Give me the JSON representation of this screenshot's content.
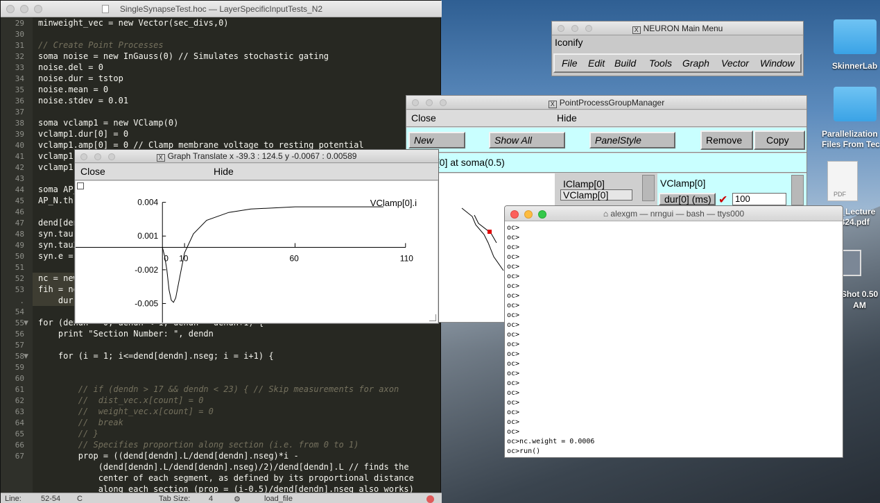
{
  "editor": {
    "title": "SingleSynapseTest.hoc — LayerSpecificInputTests_N2",
    "lines": [
      {
        "n": "29",
        "t": "minweight_vec = new Vector(sec_divs,0)"
      },
      {
        "n": "30",
        "t": ""
      },
      {
        "n": "31",
        "t": "// Create Point Processes"
      },
      {
        "n": "32",
        "t": "soma noise = new InGauss(0) // Simulates stochastic gating"
      },
      {
        "n": "33",
        "t": "noise.del = 0"
      },
      {
        "n": "34",
        "t": "noise.dur = tstop"
      },
      {
        "n": "35",
        "t": "noise.mean = 0"
      },
      {
        "n": "36",
        "t": "noise.stdev = 0.01"
      },
      {
        "n": "37",
        "t": ""
      },
      {
        "n": "38",
        "t": "soma vclamp1 = new VClamp(0)"
      },
      {
        "n": "39",
        "t": "vclamp1.dur[0] = 0"
      },
      {
        "n": "40",
        "t": "vclamp1.amp[0] = 0 // Clamp membrane voltage to resting potential"
      },
      {
        "n": "41",
        "t": "vclamp1"
      },
      {
        "n": "42",
        "t": "vclamp1"
      },
      {
        "n": "43",
        "t": ""
      },
      {
        "n": "44",
        "t": "soma AP_"
      },
      {
        "n": "45",
        "t": "AP_N.th"
      },
      {
        "n": "46",
        "t": ""
      },
      {
        "n": "47",
        "t": "dend[den"
      },
      {
        "n": "48",
        "t": "syn.tau1"
      },
      {
        "n": "49",
        "t": "syn.tau2"
      },
      {
        "n": "50",
        "t": "syn.e ="
      },
      {
        "n": "51",
        "t": ""
      },
      {
        "n": "52",
        "t": "nc = new"
      },
      {
        "n": "53",
        "t": "fih = ne"
      },
      {
        "n": ".",
        "t": "    dur"
      },
      {
        "n": "54",
        "t": ""
      },
      {
        "n": "55",
        "t": "for (dendn = 0; dendn < 1; dendn = dendn+1) {"
      },
      {
        "n": "56",
        "t": "    print \"Section Number: \", dendn"
      },
      {
        "n": "57",
        "t": ""
      },
      {
        "n": "58",
        "t": "    for (i = 1; i<=dend[dendn].nseg; i = i+1) {"
      },
      {
        "n": "59",
        "t": ""
      },
      {
        "n": "60",
        "t": ""
      },
      {
        "n": "61",
        "t": "        // if (dendn > 17 && dendn < 23) { // Skip measurements for axon"
      },
      {
        "n": "62",
        "t": "        //  dist_vec.x[count] = 0"
      },
      {
        "n": "63",
        "t": "        //  weight_vec.x[count] = 0"
      },
      {
        "n": "64",
        "t": "        //  break"
      },
      {
        "n": "65",
        "t": "        // }"
      },
      {
        "n": "",
        "t": ""
      },
      {
        "n": "66",
        "t": "        // Specifies proportion along section (i.e. from 0 to 1)"
      },
      {
        "n": "67",
        "t": "        prop = ((dend[dendn].L/dend[dendn].nseg)*i -"
      },
      {
        "n": "",
        "t": "            (dend[dendn].L/dend[dendn].nseg)/2)/dend[dendn].L // finds the"
      },
      {
        "n": "",
        "t": "            center of each segment, as defined by its proportional distance"
      },
      {
        "n": "",
        "t": "            along each section (prop = (i-0.5)/dend[dendn].nseg also works)"
      }
    ],
    "status": {
      "line_label": "Line:",
      "line_value": "52-54",
      "syntax": "C",
      "tab_label": "Tab Size:",
      "tab_value": "4",
      "symbol": "load_file"
    }
  },
  "main_menu": {
    "title": "NEURON Main Menu",
    "iconify": "Iconify",
    "menus": [
      "File",
      "Edit",
      "Build",
      "Tools",
      "Graph",
      "Vector",
      "Window"
    ]
  },
  "ppgm": {
    "title": "PointProcessGroupManager",
    "close": "Close",
    "hide": "Hide",
    "buttons": {
      "new": "New",
      "show_all": "Show All",
      "panel_style": "PanelStyle",
      "remove": "Remove",
      "copy": "Copy"
    },
    "location": "p[0] at soma(0.5)",
    "list": [
      "IClamp[0]",
      "VClamp[0]"
    ],
    "panel_title": "VClamp[0]",
    "field_label": "dur[0] (ms)",
    "field_value": "100"
  },
  "graph": {
    "title": "Graph Translate x -39.3 : 124.5  y -0.0067 : 0.00589",
    "close": "Close",
    "hide": "Hide",
    "label": "VClamp[0].i",
    "x_ticks": [
      "0",
      "10",
      "60",
      "110"
    ],
    "y_ticks": [
      "0.004",
      "0.001",
      "-0.002",
      "-0.005"
    ]
  },
  "chart_data": {
    "type": "line",
    "title": "",
    "series": [
      {
        "name": "VClamp[0].i",
        "x": [
          0,
          1,
          2,
          3,
          4,
          5,
          6,
          8,
          10,
          14,
          20,
          30,
          40,
          50,
          60,
          80,
          100
        ],
        "y": [
          0,
          -0.0008,
          -0.002,
          -0.0038,
          -0.0047,
          -0.0049,
          -0.0045,
          -0.0025,
          -0.0005,
          0.0012,
          0.0024,
          0.0031,
          0.0034,
          0.0035,
          0.0036,
          0.0036,
          0.0036
        ]
      }
    ],
    "xlim": [
      -39.3,
      124.5
    ],
    "ylim": [
      -0.0067,
      0.00589
    ]
  },
  "terminal": {
    "title": "alexgm — nrngui — bash — ttys000",
    "prompt_lines": [
      "oc>",
      "oc>",
      "oc>",
      "oc>",
      "oc>",
      "oc>",
      "oc>",
      "oc>",
      "oc>",
      "oc>",
      "oc>",
      "oc>",
      "oc>",
      "oc>",
      "oc>",
      "oc>",
      "oc>",
      "oc>",
      "oc>",
      "oc>",
      "oc>",
      "oc>"
    ],
    "cmd1": "oc>nc.weight = 0.0006",
    "cmd2": "oc>run()",
    "cursor_prompt": "oc>"
  },
  "desktop": {
    "icons": [
      "SkinnerLab",
      "Parallelization Files From Tec",
      "d_Lecture 8824.pdf",
      "Shot 0.50 AM"
    ],
    "pdf_label": "PDF"
  }
}
